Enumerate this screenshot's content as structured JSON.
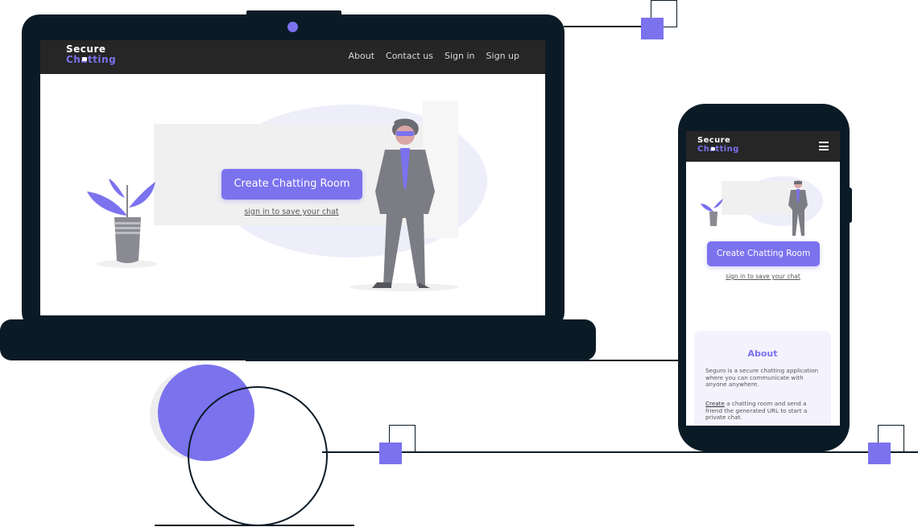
{
  "brand": {
    "line1": "Secure",
    "line2": "Chatting"
  },
  "laptop": {
    "nav": {
      "about": "About",
      "contact": "Contact us",
      "signin": "Sign in",
      "signup": "Sign up"
    },
    "cta": "Create Chatting Room",
    "save_link": "sign in to save your chat"
  },
  "phone": {
    "cta": "Create Chatting Room",
    "save_link": "sign in to save your chat",
    "about": {
      "title": "About",
      "p1": "Seguro is a secure chatting application where you can communicate with anyone anywhere.",
      "p2_link": "Create",
      "p2_rest": " a chatting room and send a friend the generated URL to start a private chat."
    }
  },
  "colors": {
    "accent": "#7b72ee",
    "dark": "#0b1b26",
    "nav": "#262626"
  },
  "icons": [
    "lock-icon",
    "hamburger-menu-icon",
    "plant-illustration",
    "person-illustration"
  ]
}
